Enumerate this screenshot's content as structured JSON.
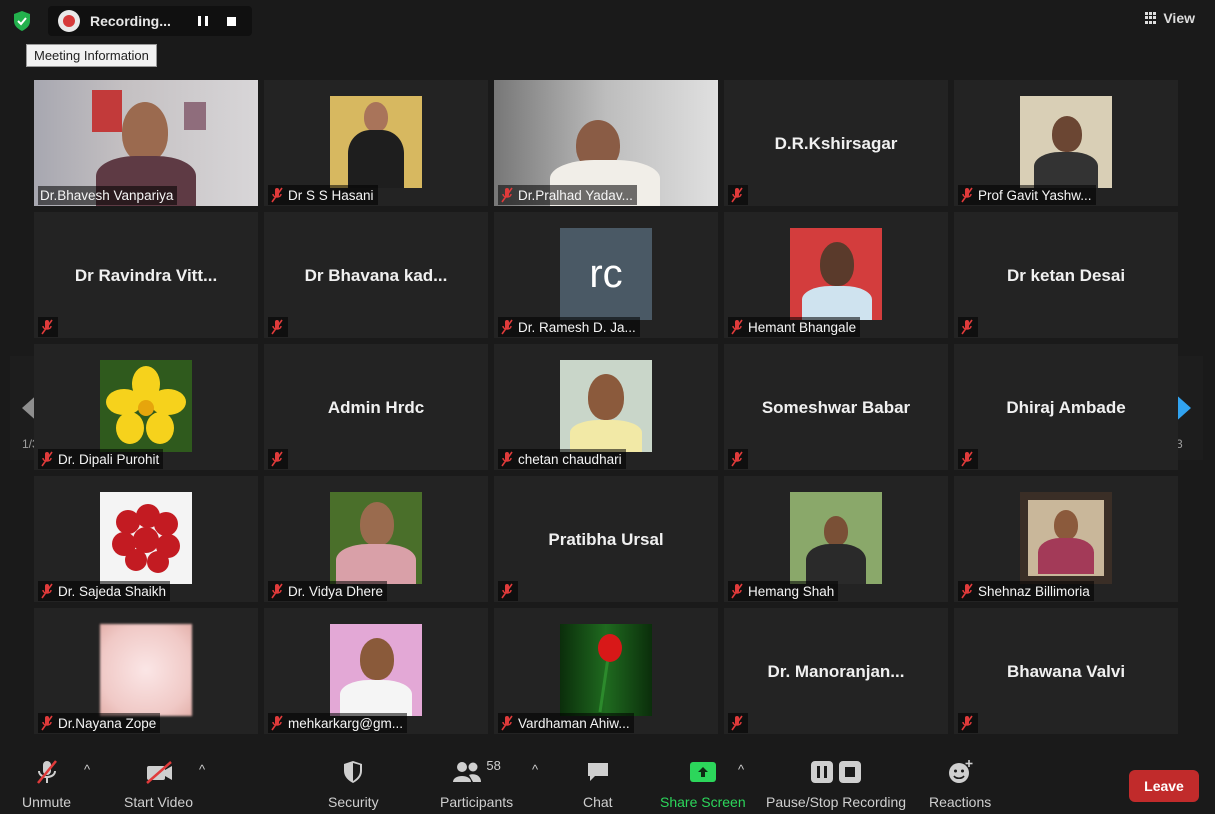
{
  "topbar": {
    "recording_label": "Recording...",
    "meeting_info": "Meeting Information",
    "view_label": "View"
  },
  "grid": {
    "tiles": [
      {
        "name": "Dr.Bhavesh Vanpariya"
      },
      {
        "name": "Dr S S Hasani"
      },
      {
        "name": "Dr.Pralhad Yadav..."
      },
      {
        "name": "D.R.Kshirsagar"
      },
      {
        "name": "Prof Gavit Yashw..."
      },
      {
        "name": "Dr Ravindra Vitt..."
      },
      {
        "name": "Dr Bhavana kad..."
      },
      {
        "name": "Dr. Ramesh D. Ja...",
        "avatar_text": "rc"
      },
      {
        "name": "Hemant Bhangale"
      },
      {
        "name": "Dr ketan Desai"
      },
      {
        "name": "Dr. Dipali Purohit"
      },
      {
        "name": "Admin Hrdc"
      },
      {
        "name": "chetan chaudhari"
      },
      {
        "name": "Someshwar Babar"
      },
      {
        "name": "Dhiraj Ambade"
      },
      {
        "name": "Dr. Sajeda Shaikh"
      },
      {
        "name": "Dr.  Vidya Dhere"
      },
      {
        "name": "Pratibha Ursal"
      },
      {
        "name": "Hemang Shah"
      },
      {
        "name": "Shehnaz Billimoria"
      },
      {
        "name": "Dr.Nayana Zope"
      },
      {
        "name": "mehkarkarg@gm..."
      },
      {
        "name": "Vardhaman Ahiw..."
      },
      {
        "name": "Dr.  Manoranjan..."
      },
      {
        "name": "Bhawana Valvi"
      }
    ]
  },
  "pagination": {
    "left": "1/3",
    "right": "1/3"
  },
  "toolbar": {
    "unmute": "Unmute",
    "start_video": "Start Video",
    "security": "Security",
    "participants": "Participants",
    "participants_count": "58",
    "chat": "Chat",
    "share_screen": "Share Screen",
    "pause_stop": "Pause/Stop Recording",
    "reactions": "Reactions",
    "leave": "Leave"
  },
  "colors": {
    "active_speaker_border": "#c3e33a",
    "share_green": "#2cd65b",
    "leave_red": "#c12b2b",
    "mute_red": "#e03b3b"
  }
}
